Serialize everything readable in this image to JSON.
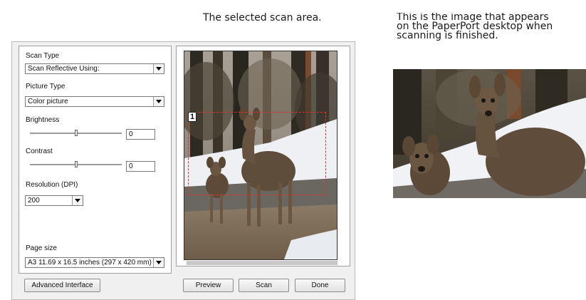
{
  "captions": {
    "scan_area": "The selected scan area.",
    "result_line1": "This is the image that appears",
    "result_line2": "on the PaperPort desktop when",
    "result_line3": "scanning is finished."
  },
  "settings": {
    "scan_type": {
      "label": "Scan Type",
      "value": "Scan Reflective Using:"
    },
    "picture_type": {
      "label": "Picture Type",
      "value": "Color picture"
    },
    "brightness": {
      "label": "Brightness",
      "value": "0"
    },
    "contrast": {
      "label": "Contrast",
      "value": "0"
    },
    "resolution": {
      "label": "Resolution (DPI)",
      "value": "200"
    },
    "page_size": {
      "label": "Page size",
      "value": "A3 11.69 x 16.5 inches (297 x 420 mm)"
    }
  },
  "buttons": {
    "advanced": "Advanced Interface",
    "preview": "Preview",
    "scan": "Scan",
    "done": "Done"
  },
  "preview": {
    "selection_number": "1"
  }
}
